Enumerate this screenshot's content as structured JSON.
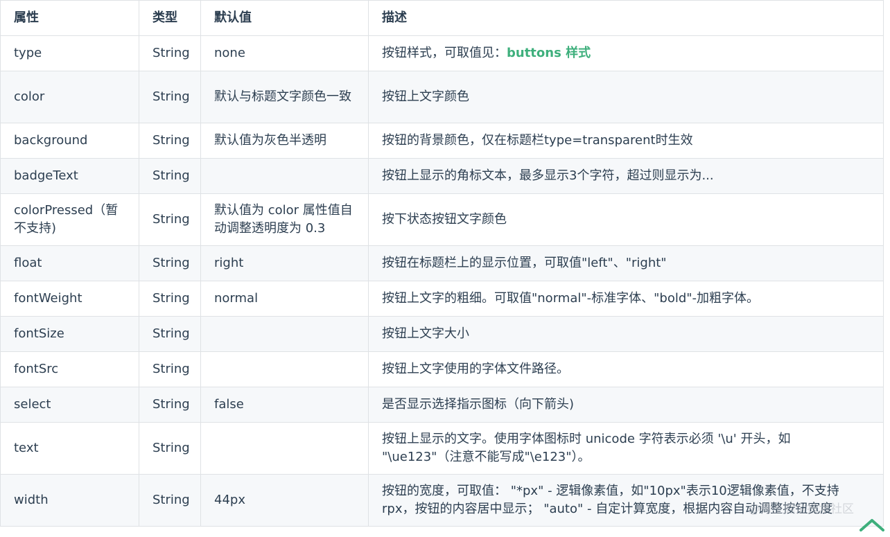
{
  "table": {
    "headers": [
      "属性",
      "类型",
      "默认值",
      "描述"
    ],
    "rows": [
      {
        "attr": "type",
        "type": "String",
        "default": "none",
        "desc": "按钮样式，可取值见：",
        "desc_link": "buttons 样式"
      },
      {
        "attr": "color",
        "type": "String",
        "default": "默认与标题文字颜色一致",
        "desc": "按钮上文字颜色"
      },
      {
        "attr": "background",
        "type": "String",
        "default": "默认值为灰色半透明",
        "desc": "按钮的背景颜色，仅在标题栏type=transparent时生效"
      },
      {
        "attr": "badgeText",
        "type": "String",
        "default": "",
        "desc": "按钮上显示的角标文本，最多显示3个字符，超过则显示为..."
      },
      {
        "attr": "colorPressed（暂不支持)",
        "type": "String",
        "default": "默认值为 color 属性值自动调整透明度为 0.3",
        "desc": "按下状态按钮文字颜色"
      },
      {
        "attr": "float",
        "type": "String",
        "default": "right",
        "desc": "按钮在标题栏上的显示位置，可取值\"left\"、\"right\""
      },
      {
        "attr": "fontWeight",
        "type": "String",
        "default": "normal",
        "desc": "按钮上文字的粗细。可取值\"normal\"-标准字体、\"bold\"-加粗字体。"
      },
      {
        "attr": "fontSize",
        "type": "String",
        "default": "",
        "desc": "按钮上文字大小"
      },
      {
        "attr": "fontSrc",
        "type": "String",
        "default": "",
        "desc": "按钮上文字使用的字体文件路径。"
      },
      {
        "attr": "select",
        "type": "String",
        "default": "false",
        "desc": "是否显示选择指示图标（向下箭头)"
      },
      {
        "attr": "text",
        "type": "String",
        "default": "",
        "desc": "按钮上显示的文字。使用字体图标时 unicode 字符表示必须 '\\u' 开头，如 \"\\ue123\"（注意不能写成\"\\e123\"）。"
      },
      {
        "attr": "width",
        "type": "String",
        "default": "44px",
        "desc": "按钮的宽度，可取值： \"*px\" - 逻辑像素值，如\"10px\"表示10逻辑像素值，不支持rpx，按钮的内容居中显示； \"auto\" - 自定计算宽度，根据内容自动调整按钮宽度"
      }
    ]
  },
  "watermark": "@稀土掘金技术社区",
  "colors": {
    "link": "#3eaf7c",
    "text": "#2c3e50",
    "border": "#dfe2e5",
    "stripe": "#f6f8fa"
  },
  "icons": {
    "back_to_top": "chevron-up-icon"
  }
}
